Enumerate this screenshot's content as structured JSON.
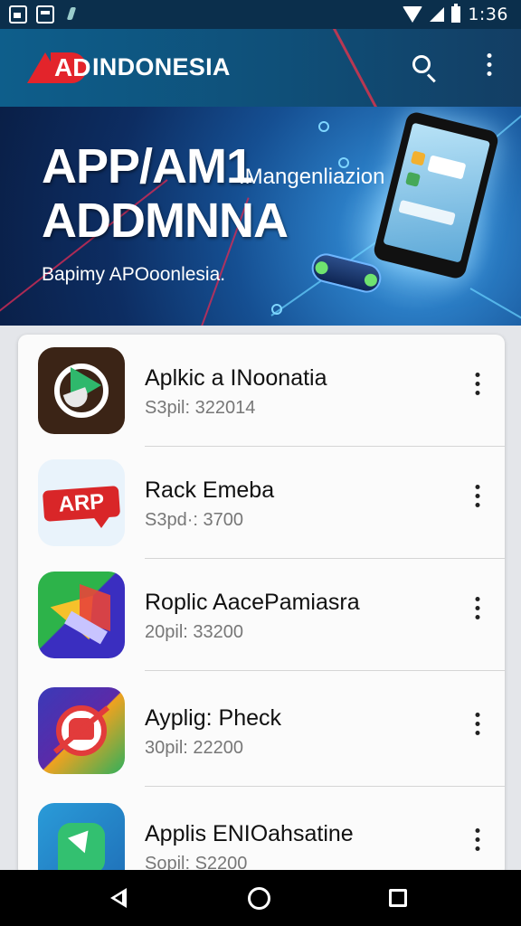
{
  "status_bar": {
    "time": "1:36",
    "icons": [
      "photo-notification-icon",
      "message-notification-icon",
      "hand-notification-icon",
      "wifi-icon",
      "signal-icon",
      "battery-icon"
    ]
  },
  "app_bar": {
    "logo_mark": "AD",
    "title": "INDONESIA",
    "actions": [
      "search-icon",
      "more-vert-icon"
    ],
    "colors": {
      "background": "#0f5680",
      "logo_red": "#e3242b"
    }
  },
  "banner": {
    "title_line1": "APP/AM1",
    "title_line2": "ADDMNNA",
    "subtitle": "IMangenliazion",
    "tagline": "Bapimy APOoonlesia."
  },
  "apps": [
    {
      "title": "Aplkic a INoonatia",
      "subtitle": "S3pil:  322014",
      "icon": "play-circle-icon"
    },
    {
      "title": "Rack Emeba",
      "subtitle": "S3pd·:  3700",
      "icon": "app-badge-icon",
      "icon_text": "ARP"
    },
    {
      "title": "Roplic AacePamiasra",
      "subtitle": "20pil:  33200",
      "icon": "colorful-play-icon"
    },
    {
      "title": "Ayplig: Pheck",
      "subtitle": "30pil:  22200",
      "icon": "android-blocked-icon"
    },
    {
      "title": "Applis ENIOahsatine",
      "subtitle": "Sopil:  S2200",
      "icon": "green-play-icon"
    }
  ],
  "nav_bar": {
    "buttons": [
      "back-icon",
      "home-icon",
      "recents-icon"
    ]
  }
}
